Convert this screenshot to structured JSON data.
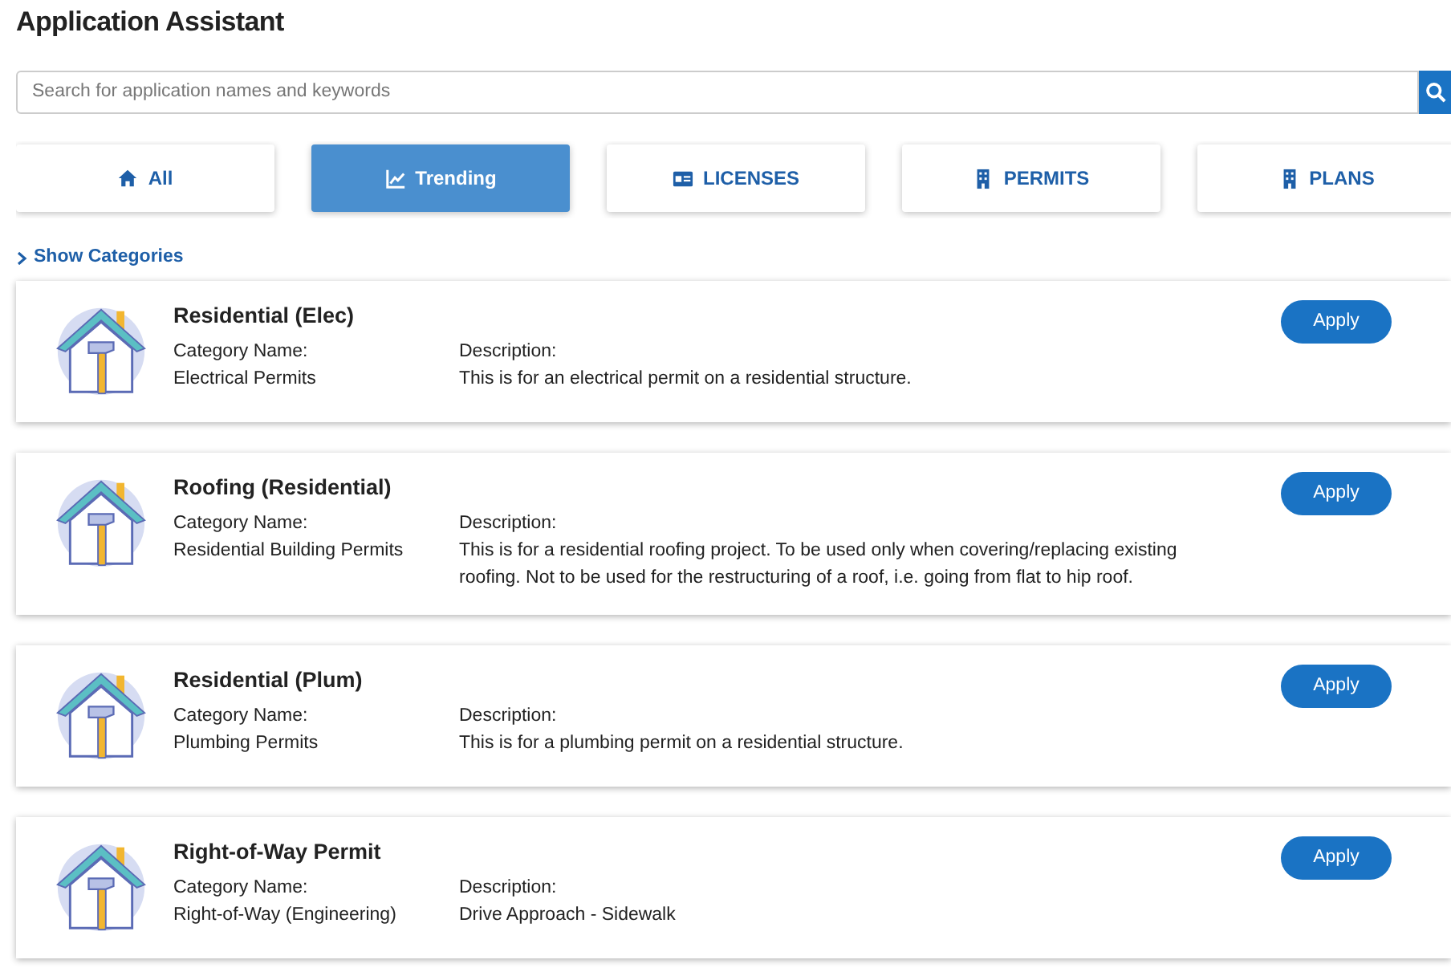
{
  "page_title": "Application Assistant",
  "search": {
    "placeholder": "Search for application names and keywords"
  },
  "tabs": [
    {
      "label": "All",
      "selected": false
    },
    {
      "label": "Trending",
      "selected": true
    },
    {
      "label": "LICENSES",
      "selected": false
    },
    {
      "label": "PERMITS",
      "selected": false
    },
    {
      "label": "PLANS",
      "selected": false
    }
  ],
  "categories_toggle": {
    "label": "Show Categories",
    "expanded": false
  },
  "applications": [
    {
      "title": "Residential (Elec)",
      "category_label": "Category Name:",
      "category": "Electrical Permits",
      "description_label": "Description:",
      "description": "This is for an electrical permit on a residential structure.",
      "button": "Apply"
    },
    {
      "title": "Roofing (Residential)",
      "category_label": "Category Name:",
      "category": "Residential Building Permits",
      "description_label": "Description:",
      "description": "This is for a residential roofing project. To be used only when covering/replacing existing roofing. Not to be used for the restructuring of a roof, i.e. going from flat to hip roof.",
      "button": "Apply"
    },
    {
      "title": "Residential (Plum)",
      "category_label": "Category Name:",
      "category": "Plumbing Permits",
      "description_label": "Description:",
      "description": "This is for a plumbing permit on a residential structure.",
      "button": "Apply"
    },
    {
      "title": "Right-of-Way Permit",
      "category_label": "Category Name:",
      "category": "Right-of-Way (Engineering)",
      "description_label": "Description:",
      "description": "Drive Approach - Sidewalk",
      "button": "Apply"
    }
  ]
}
